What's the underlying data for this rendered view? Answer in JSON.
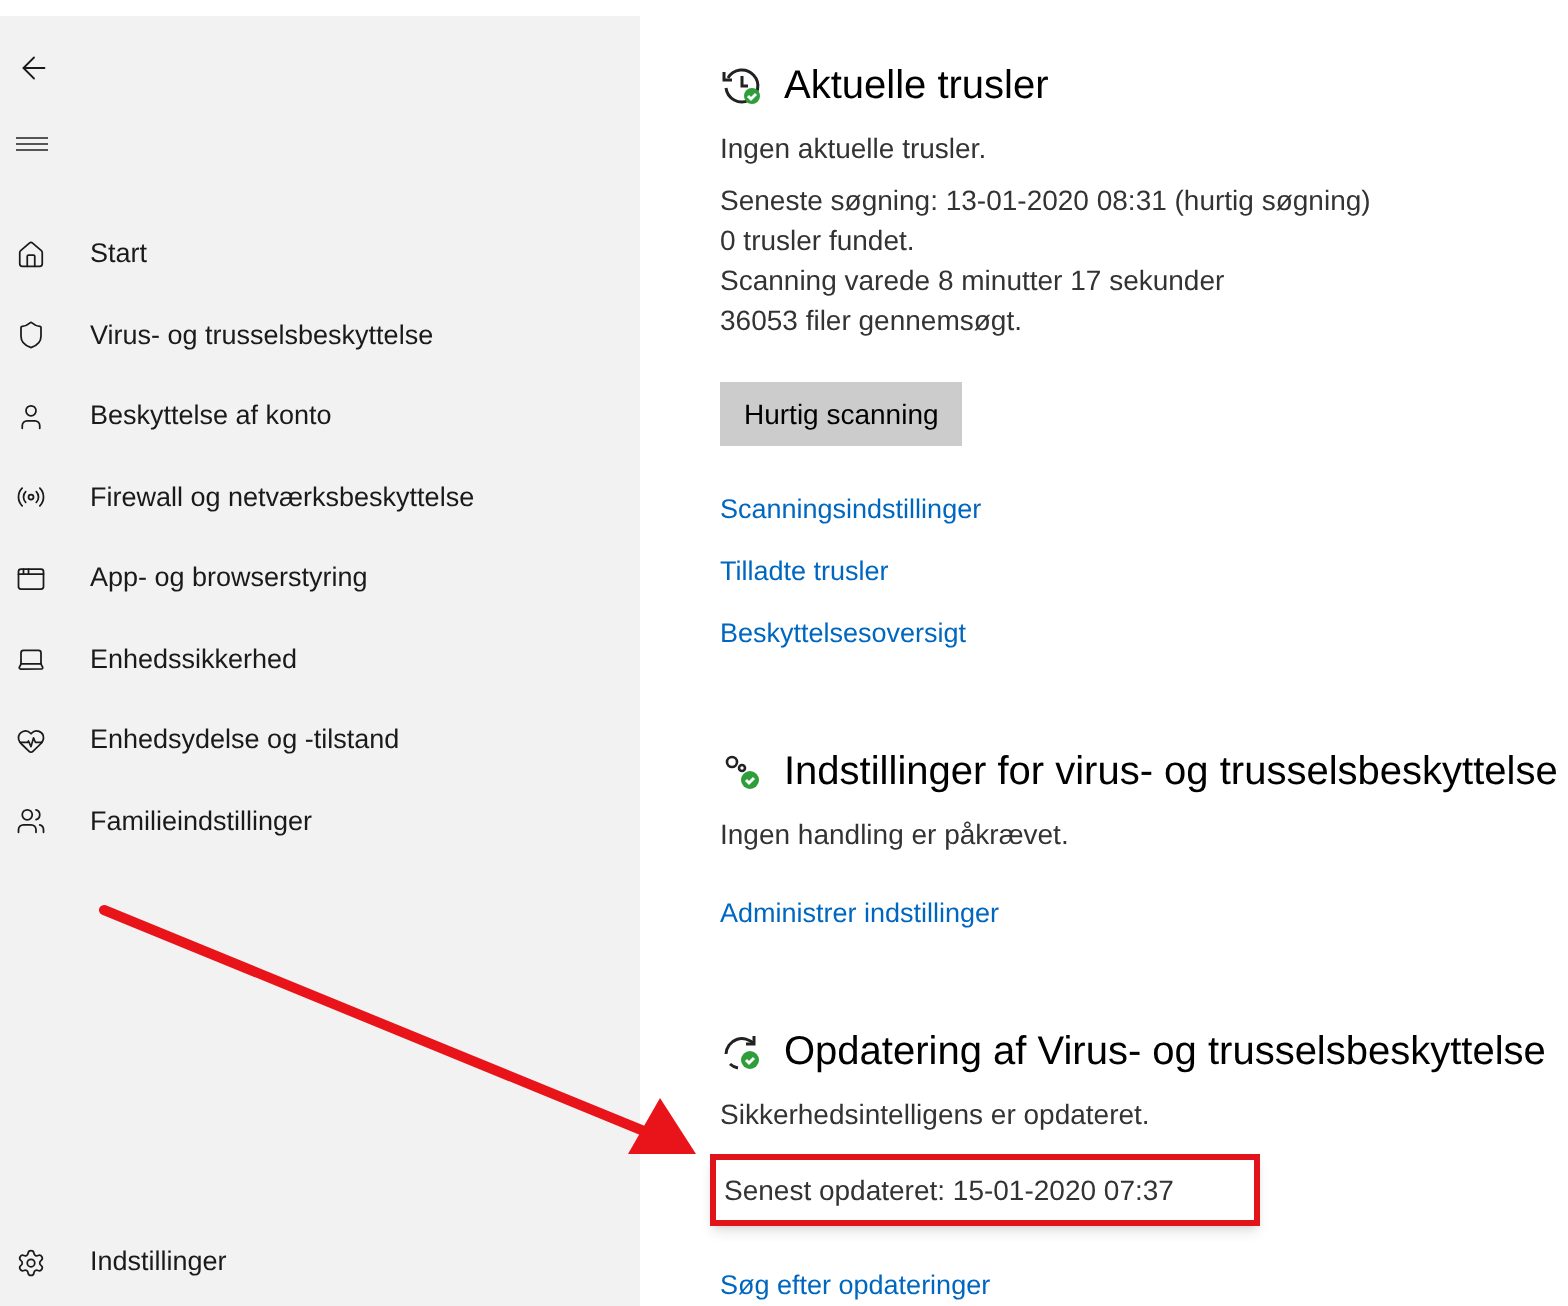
{
  "sidebar": {
    "items": [
      {
        "label": "Start"
      },
      {
        "label": "Virus- og trusselsbeskyttelse"
      },
      {
        "label": "Beskyttelse af konto"
      },
      {
        "label": "Firewall og netværksbeskyttelse"
      },
      {
        "label": "App- og browserstyring"
      },
      {
        "label": "Enhedssikkerhed"
      },
      {
        "label": "Enhedsydelse og -tilstand"
      },
      {
        "label": "Familieindstillinger"
      }
    ],
    "settings": "Indstillinger"
  },
  "sections": [
    {
      "title": "Aktuelle trusler",
      "status": "Ingen aktuelle trusler.",
      "details": [
        {
          "text": "Seneste søgning: 13-01-2020 08:31 (hurtig søgning)",
          "highlighted": false
        },
        {
          "text": "0 trusler fundet.",
          "highlighted": false
        },
        {
          "text": "Scanning varede 8 minutter 17 sekunder",
          "highlighted": false
        },
        {
          "text": "36053 filer gennemsøgt.",
          "highlighted": false
        }
      ],
      "button": "Hurtig scanning",
      "links": [
        "Scanningsindstillinger",
        "Tilladte trusler",
        "Beskyttelsesoversigt"
      ]
    },
    {
      "title": "Indstillinger for virus- og trusselsbeskyttelse",
      "status": "Ingen handling er påkrævet.",
      "links": [
        "Administrer indstillinger"
      ]
    },
    {
      "title": "Opdatering af Virus- og trusselsbeskyttelse",
      "status": "Sikkerhedsintelligens er opdateret.",
      "details": [
        {
          "text": "Senest opdateret: 15-01-2020 07:37",
          "highlighted": true
        }
      ],
      "links": [
        "Søg efter opdateringer"
      ]
    }
  ]
}
